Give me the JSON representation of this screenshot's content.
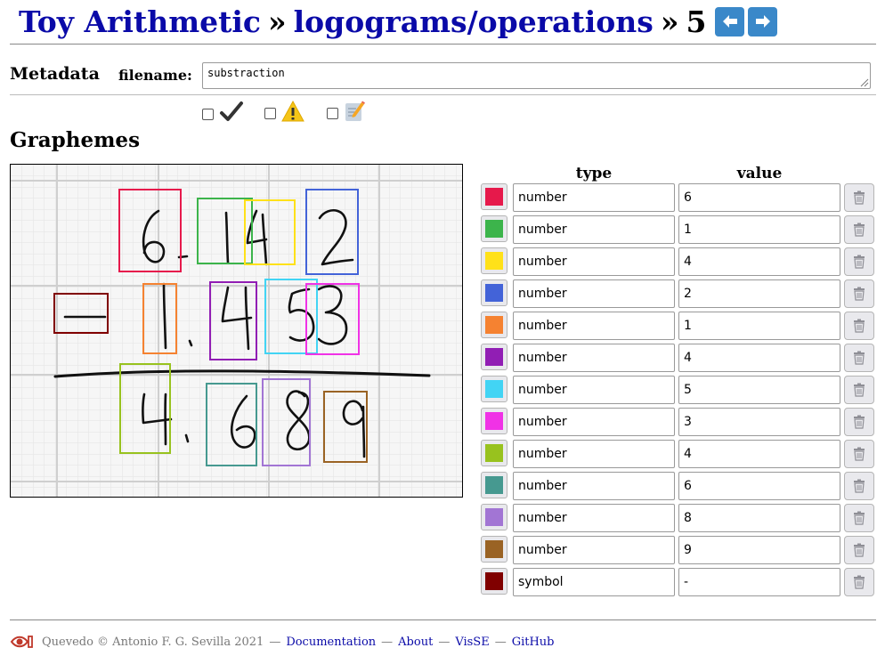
{
  "header": {
    "app_title": "Toy Arithmetic",
    "separator": "»",
    "collection": "logograms/operations",
    "item_number": "5",
    "prev_icon": "arrow-left-icon",
    "next_icon": "arrow-right-icon",
    "nav_color": "#3a88c9",
    "link_color": "#0a0aa8"
  },
  "metadata": {
    "section_title": "Metadata",
    "filename_label": "filename:",
    "filename_value": "substraction",
    "flags": [
      {
        "icon": "checkmark-icon",
        "checked": false
      },
      {
        "icon": "warning-icon",
        "checked": false
      },
      {
        "icon": "memo-icon",
        "checked": false
      }
    ]
  },
  "graphemes": {
    "section_title": "Graphemes",
    "columns": {
      "type": "type",
      "value": "value"
    },
    "delete_icon": "trash-icon",
    "rows": [
      {
        "color": "#e6194b",
        "type": "number",
        "value": "6"
      },
      {
        "color": "#3cb44b",
        "type": "number",
        "value": "1"
      },
      {
        "color": "#ffe119",
        "type": "number",
        "value": "4"
      },
      {
        "color": "#4363d8",
        "type": "number",
        "value": "2"
      },
      {
        "color": "#f58231",
        "type": "number",
        "value": "1"
      },
      {
        "color": "#911eb4",
        "type": "number",
        "value": "4"
      },
      {
        "color": "#42d4f4",
        "type": "number",
        "value": "5"
      },
      {
        "color": "#f032e6",
        "type": "number",
        "value": "3"
      },
      {
        "color": "#98c21e",
        "type": "number",
        "value": "4"
      },
      {
        "color": "#469990",
        "type": "number",
        "value": "6"
      },
      {
        "color": "#a275d4",
        "type": "number",
        "value": "8"
      },
      {
        "color": "#9a6324",
        "type": "number",
        "value": "9"
      },
      {
        "color": "#800000",
        "type": "symbol",
        "value": "-"
      }
    ]
  },
  "footer": {
    "logo_icon": "eye-logo-icon",
    "credit": "Quevedo © Antonio F. G. Sevilla 2021",
    "separator": "—",
    "links": [
      "Documentation",
      "About",
      "VisSE",
      "GitHub"
    ]
  }
}
